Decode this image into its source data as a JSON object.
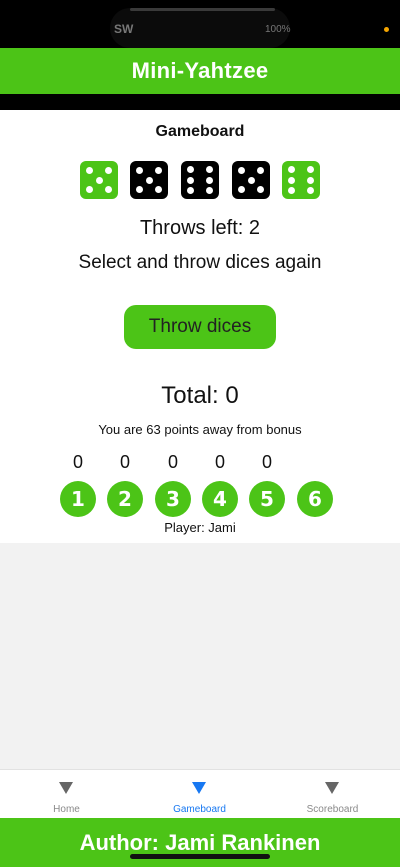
{
  "status_bar": {
    "left_text": "SW",
    "right_text": "100%",
    "privacy_dot_color": "#f5a500"
  },
  "header": {
    "title": "Mini-Yahtzee"
  },
  "gameboard": {
    "title": "Gameboard",
    "dice": [
      {
        "value": 5,
        "selected": true
      },
      {
        "value": 5,
        "selected": false
      },
      {
        "value": 6,
        "selected": false
      },
      {
        "value": 5,
        "selected": false
      },
      {
        "value": 6,
        "selected": true
      }
    ],
    "throws_left": "Throws left: 2",
    "status_message": "Select and throw dices again",
    "throw_button_label": "Throw dices",
    "total": "Total: 0",
    "bonus_message": "You are 63 points away from bonus",
    "points": [
      {
        "value": "0",
        "label": "1"
      },
      {
        "value": "0",
        "label": "2"
      },
      {
        "value": "0",
        "label": "3"
      },
      {
        "value": "0",
        "label": "4"
      },
      {
        "value": "0",
        "label": "5"
      },
      {
        "value": "",
        "label": "6"
      }
    ],
    "player": "Player: Jami"
  },
  "tabs": [
    {
      "label": "Home",
      "active": false
    },
    {
      "label": "Gameboard",
      "active": true
    },
    {
      "label": "Scoreboard",
      "active": false
    }
  ],
  "footer": {
    "author": "Author: Jami Rankinen"
  },
  "colors": {
    "accent_green": "#4cc417",
    "active_tab": "#1778f2",
    "die_unselected": "#000000"
  }
}
